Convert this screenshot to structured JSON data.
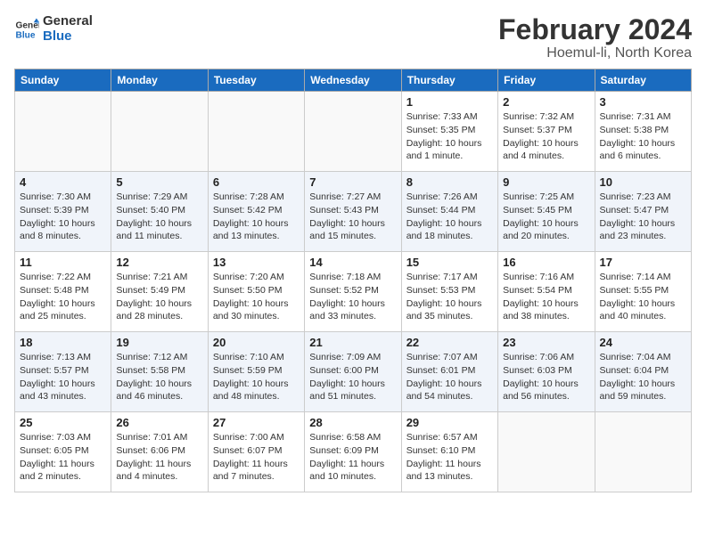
{
  "header": {
    "logo_line1": "General",
    "logo_line2": "Blue",
    "title": "February 2024",
    "subtitle": "Hoemul-li, North Korea"
  },
  "columns": [
    "Sunday",
    "Monday",
    "Tuesday",
    "Wednesday",
    "Thursday",
    "Friday",
    "Saturday"
  ],
  "weeks": [
    [
      {
        "day": "",
        "info": ""
      },
      {
        "day": "",
        "info": ""
      },
      {
        "day": "",
        "info": ""
      },
      {
        "day": "",
        "info": ""
      },
      {
        "day": "1",
        "info": "Sunrise: 7:33 AM\nSunset: 5:35 PM\nDaylight: 10 hours\nand 1 minute."
      },
      {
        "day": "2",
        "info": "Sunrise: 7:32 AM\nSunset: 5:37 PM\nDaylight: 10 hours\nand 4 minutes."
      },
      {
        "day": "3",
        "info": "Sunrise: 7:31 AM\nSunset: 5:38 PM\nDaylight: 10 hours\nand 6 minutes."
      }
    ],
    [
      {
        "day": "4",
        "info": "Sunrise: 7:30 AM\nSunset: 5:39 PM\nDaylight: 10 hours\nand 8 minutes."
      },
      {
        "day": "5",
        "info": "Sunrise: 7:29 AM\nSunset: 5:40 PM\nDaylight: 10 hours\nand 11 minutes."
      },
      {
        "day": "6",
        "info": "Sunrise: 7:28 AM\nSunset: 5:42 PM\nDaylight: 10 hours\nand 13 minutes."
      },
      {
        "day": "7",
        "info": "Sunrise: 7:27 AM\nSunset: 5:43 PM\nDaylight: 10 hours\nand 15 minutes."
      },
      {
        "day": "8",
        "info": "Sunrise: 7:26 AM\nSunset: 5:44 PM\nDaylight: 10 hours\nand 18 minutes."
      },
      {
        "day": "9",
        "info": "Sunrise: 7:25 AM\nSunset: 5:45 PM\nDaylight: 10 hours\nand 20 minutes."
      },
      {
        "day": "10",
        "info": "Sunrise: 7:23 AM\nSunset: 5:47 PM\nDaylight: 10 hours\nand 23 minutes."
      }
    ],
    [
      {
        "day": "11",
        "info": "Sunrise: 7:22 AM\nSunset: 5:48 PM\nDaylight: 10 hours\nand 25 minutes."
      },
      {
        "day": "12",
        "info": "Sunrise: 7:21 AM\nSunset: 5:49 PM\nDaylight: 10 hours\nand 28 minutes."
      },
      {
        "day": "13",
        "info": "Sunrise: 7:20 AM\nSunset: 5:50 PM\nDaylight: 10 hours\nand 30 minutes."
      },
      {
        "day": "14",
        "info": "Sunrise: 7:18 AM\nSunset: 5:52 PM\nDaylight: 10 hours\nand 33 minutes."
      },
      {
        "day": "15",
        "info": "Sunrise: 7:17 AM\nSunset: 5:53 PM\nDaylight: 10 hours\nand 35 minutes."
      },
      {
        "day": "16",
        "info": "Sunrise: 7:16 AM\nSunset: 5:54 PM\nDaylight: 10 hours\nand 38 minutes."
      },
      {
        "day": "17",
        "info": "Sunrise: 7:14 AM\nSunset: 5:55 PM\nDaylight: 10 hours\nand 40 minutes."
      }
    ],
    [
      {
        "day": "18",
        "info": "Sunrise: 7:13 AM\nSunset: 5:57 PM\nDaylight: 10 hours\nand 43 minutes."
      },
      {
        "day": "19",
        "info": "Sunrise: 7:12 AM\nSunset: 5:58 PM\nDaylight: 10 hours\nand 46 minutes."
      },
      {
        "day": "20",
        "info": "Sunrise: 7:10 AM\nSunset: 5:59 PM\nDaylight: 10 hours\nand 48 minutes."
      },
      {
        "day": "21",
        "info": "Sunrise: 7:09 AM\nSunset: 6:00 PM\nDaylight: 10 hours\nand 51 minutes."
      },
      {
        "day": "22",
        "info": "Sunrise: 7:07 AM\nSunset: 6:01 PM\nDaylight: 10 hours\nand 54 minutes."
      },
      {
        "day": "23",
        "info": "Sunrise: 7:06 AM\nSunset: 6:03 PM\nDaylight: 10 hours\nand 56 minutes."
      },
      {
        "day": "24",
        "info": "Sunrise: 7:04 AM\nSunset: 6:04 PM\nDaylight: 10 hours\nand 59 minutes."
      }
    ],
    [
      {
        "day": "25",
        "info": "Sunrise: 7:03 AM\nSunset: 6:05 PM\nDaylight: 11 hours\nand 2 minutes."
      },
      {
        "day": "26",
        "info": "Sunrise: 7:01 AM\nSunset: 6:06 PM\nDaylight: 11 hours\nand 4 minutes."
      },
      {
        "day": "27",
        "info": "Sunrise: 7:00 AM\nSunset: 6:07 PM\nDaylight: 11 hours\nand 7 minutes."
      },
      {
        "day": "28",
        "info": "Sunrise: 6:58 AM\nSunset: 6:09 PM\nDaylight: 11 hours\nand 10 minutes."
      },
      {
        "day": "29",
        "info": "Sunrise: 6:57 AM\nSunset: 6:10 PM\nDaylight: 11 hours\nand 13 minutes."
      },
      {
        "day": "",
        "info": ""
      },
      {
        "day": "",
        "info": ""
      }
    ]
  ]
}
